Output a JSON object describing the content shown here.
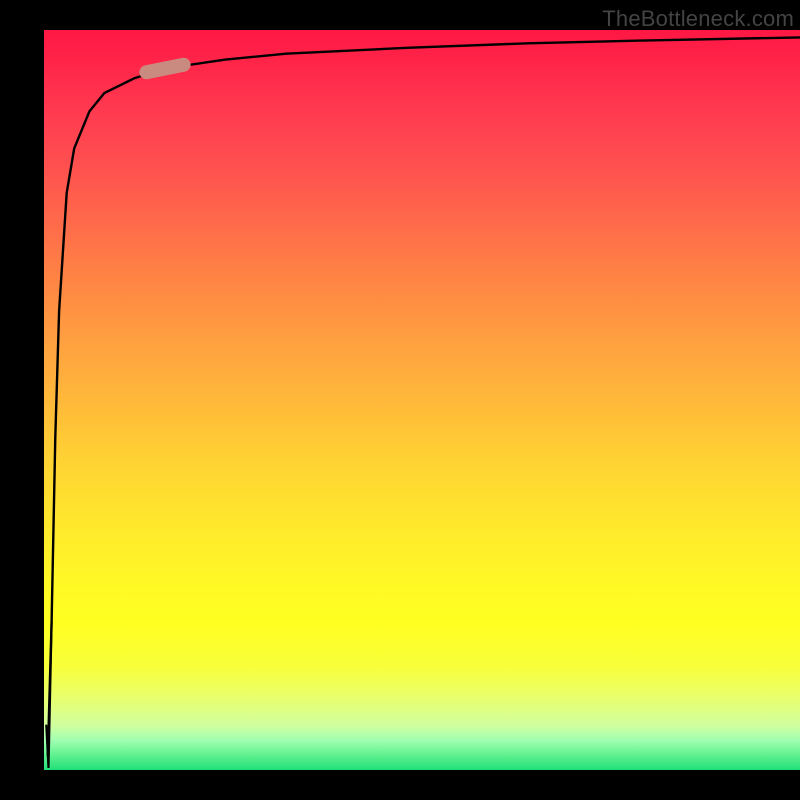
{
  "watermark": "TheBottleneck.com",
  "colors": {
    "frame": "#000000",
    "curve": "#000000",
    "marker_fill": "#c98a80",
    "marker_stroke": "#a86a60"
  },
  "chart_data": {
    "type": "line",
    "title": "",
    "xlabel": "",
    "ylabel": "",
    "xlim": [
      0,
      100
    ],
    "ylim": [
      0,
      100
    ],
    "grid": false,
    "legend": false,
    "background_gradient": [
      "#ff1744",
      "#ffff20",
      "#20e078"
    ],
    "x": [
      0.5,
      1,
      1.5,
      2,
      3,
      4,
      6,
      8,
      12,
      16,
      24,
      32,
      48,
      64,
      80,
      100
    ],
    "values": [
      2,
      20,
      45,
      62,
      78,
      84,
      89,
      91.5,
      93.5,
      94.8,
      96,
      96.8,
      97.6,
      98.2,
      98.6,
      99
    ],
    "marker": {
      "x": 16,
      "y": 94.8
    },
    "annotations": []
  }
}
